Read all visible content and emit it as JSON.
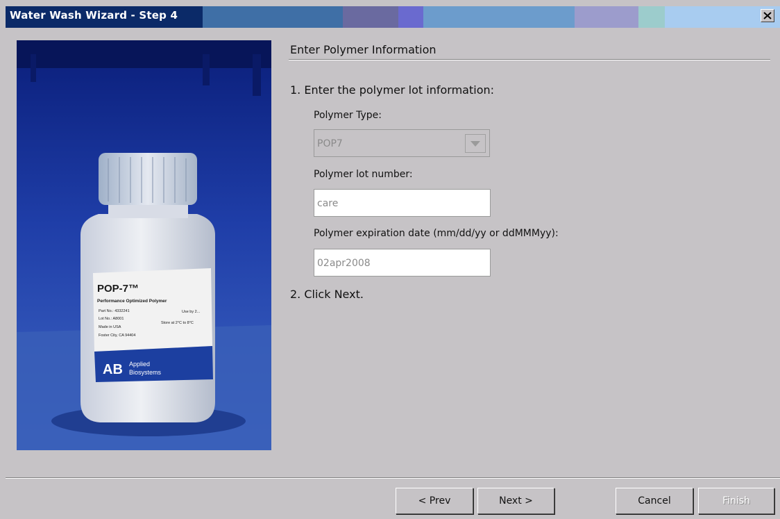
{
  "window": {
    "title": "Water Wash Wizard - Step 4",
    "title_bar_colors": [
      "#0b2a68",
      "#3f6fa6",
      "#6a6aa0",
      "#6a6acf",
      "#6c9ccc",
      "#9c9ccc",
      "#9ccccc",
      "#a8ccf0"
    ]
  },
  "product_image": {
    "label_name": "POP-7™",
    "label_subtitle": "Performance Optimized Polymer",
    "label_lines": [
      "Part No.: 4332241",
      "Lot No.: A8001",
      "Made in USA",
      "Foster City, CA 94404"
    ],
    "label_side_text": [
      "Use by 2...",
      "Store at 2°C to 8°C"
    ],
    "brand_logo": "AB",
    "brand_line1": "Applied",
    "brand_line2": "Biosystems"
  },
  "content": {
    "section_title": "Enter Polymer Information",
    "step1": "1. Enter the polymer lot information:",
    "polymer_type_label": "Polymer Type:",
    "polymer_type_value": "POP7",
    "lot_number_label": "Polymer lot number:",
    "lot_number_value": "care",
    "expiration_label": "Polymer expiration date (mm/dd/yy or ddMMMyy):",
    "expiration_value": "02apr2008",
    "step2": "2.  Click Next."
  },
  "buttons": {
    "prev": "< Prev",
    "next": "Next >",
    "cancel": "Cancel",
    "finish": "Finish"
  },
  "icons": {
    "close": "close-icon",
    "dropdown": "chevron-down-icon"
  }
}
